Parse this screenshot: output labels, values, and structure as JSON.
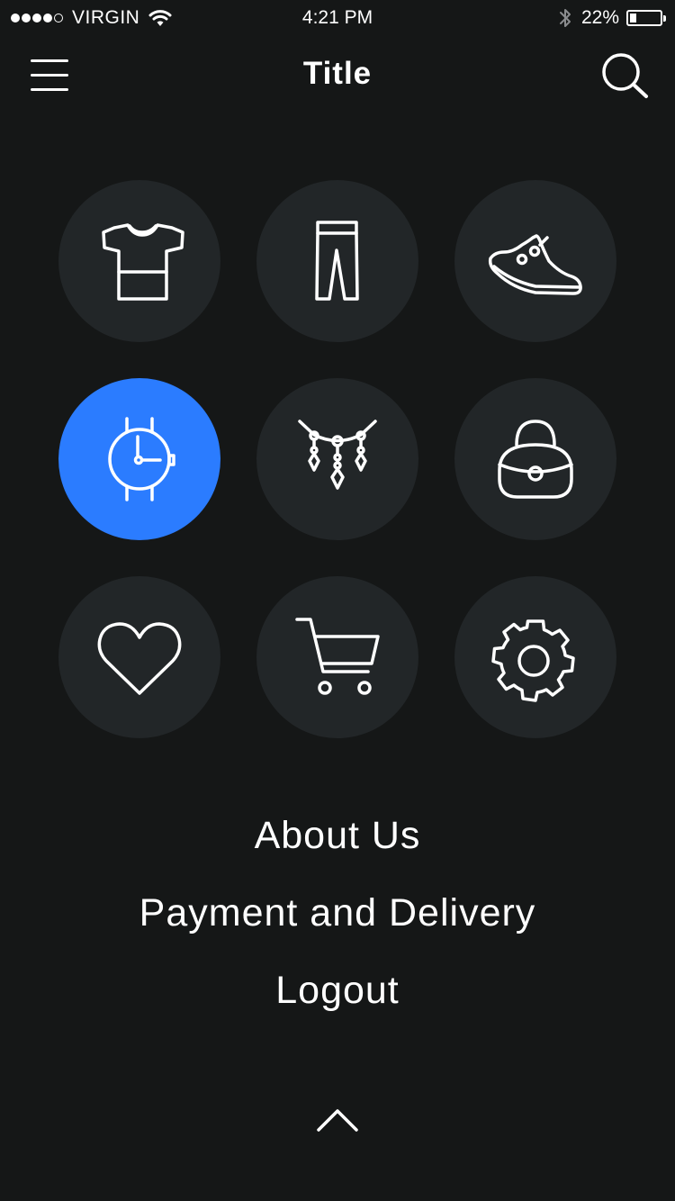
{
  "status_bar": {
    "signal_bars_total": 5,
    "signal_bars_filled": 4,
    "carrier": "VIRGIN",
    "time": "4:21 PM",
    "battery_percent": 22,
    "battery_label": "22%",
    "icons": [
      "wifi-icon",
      "bluetooth-icon",
      "battery-icon"
    ]
  },
  "nav": {
    "title": "Title",
    "menu_icon": "hamburger-menu-icon",
    "search_icon": "search-icon"
  },
  "categories": [
    {
      "icon": "tshirt-icon",
      "active": false
    },
    {
      "icon": "pants-icon",
      "active": false
    },
    {
      "icon": "sneaker-icon",
      "active": false
    },
    {
      "icon": "watch-icon",
      "active": true
    },
    {
      "icon": "necklace-icon",
      "active": false
    },
    {
      "icon": "handbag-icon",
      "active": false
    },
    {
      "icon": "heart-icon",
      "active": false
    },
    {
      "icon": "cart-icon",
      "active": false
    },
    {
      "icon": "gear-icon",
      "active": false
    }
  ],
  "colors": {
    "background": "#151717",
    "tile": "#222628",
    "tile_active": "#2b7cff",
    "text": "#ffffff"
  },
  "links": {
    "about": "About Us",
    "payment": "Payment and Delivery",
    "logout": "Logout"
  },
  "collapse_icon": "chevron-up-icon"
}
